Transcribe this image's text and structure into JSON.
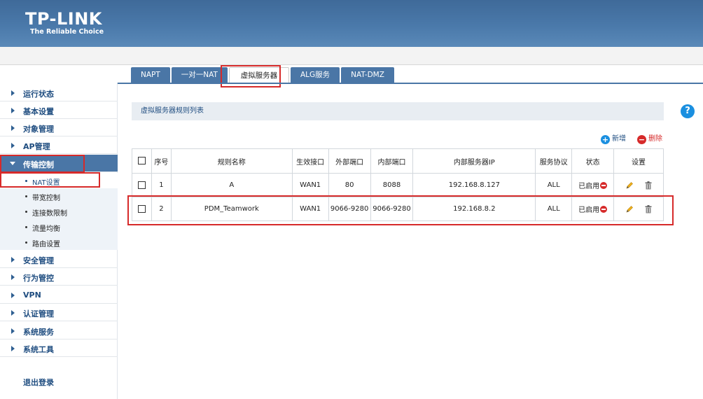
{
  "brand": {
    "name": "TP-LINK",
    "tagline": "The Reliable Choice"
  },
  "tabs": [
    {
      "label": "NAPT",
      "active": false
    },
    {
      "label": "一对一NAT",
      "active": false
    },
    {
      "label": "虚拟服务器",
      "active": true
    },
    {
      "label": "ALG服务",
      "active": false
    },
    {
      "label": "NAT-DMZ",
      "active": false
    }
  ],
  "sidebar": {
    "items": [
      {
        "label": "运行状态"
      },
      {
        "label": "基本设置"
      },
      {
        "label": "对象管理"
      },
      {
        "label": "AP管理"
      },
      {
        "label": "传输控制",
        "expanded": true
      },
      {
        "label": "安全管理"
      },
      {
        "label": "行为管控"
      },
      {
        "label": "VPN"
      },
      {
        "label": "认证管理"
      },
      {
        "label": "系统服务"
      },
      {
        "label": "系统工具"
      }
    ],
    "subitems": [
      {
        "label": "NAT设置",
        "active": true
      },
      {
        "label": "带宽控制"
      },
      {
        "label": "连接数限制"
      },
      {
        "label": "流量均衡"
      },
      {
        "label": "路由设置"
      }
    ],
    "logout": "退出登录"
  },
  "panel": {
    "title": "虚拟服务器规则列表",
    "help_icon": "?"
  },
  "actions": {
    "add": "新增",
    "delete": "删除"
  },
  "table": {
    "headers": [
      "序号",
      "规则名称",
      "生效接口",
      "外部端口",
      "内部端口",
      "内部服务器IP",
      "服务协议",
      "状态",
      "设置"
    ],
    "rows": [
      {
        "index": "1",
        "name": "A",
        "interface": "WAN1",
        "ext_port": "80",
        "int_port": "8088",
        "server_ip": "192.168.8.127",
        "protocol": "ALL",
        "status": "已启用"
      },
      {
        "index": "2",
        "name": "PDM_Teamwork",
        "interface": "WAN1",
        "ext_port": "9066-9280",
        "int_port": "9066-9280",
        "server_ip": "192.168.8.2",
        "protocol": "ALL",
        "status": "已启用"
      }
    ]
  },
  "colors": {
    "header_blue": "#4a79aa",
    "highlight_red": "#d62a2a",
    "accent_blue": "#1a8fe0"
  }
}
